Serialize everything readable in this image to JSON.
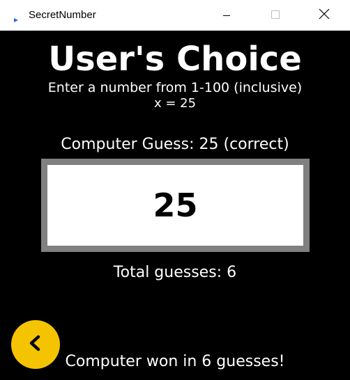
{
  "window": {
    "title": "SecretNumber",
    "icons": {
      "app": "app-icon",
      "minimize": "minimize-icon",
      "maximize": "maximize-icon",
      "close": "close-icon"
    }
  },
  "main": {
    "heading": "User's Choice",
    "instructions": "Enter a number from 1-100 (inclusive)",
    "x_value": "x = 25",
    "guess_label": "Computer Guess: 25 (correct)",
    "guess_number": "25",
    "total_guesses": "Total guesses: 6",
    "result": "Computer won in 6 guesses!"
  },
  "back_button": {
    "icon": "chevron-left-icon"
  },
  "colors": {
    "background": "#000000",
    "text": "#ffffff",
    "box_border": "#808080",
    "box_fill": "#ffffff",
    "back_button": "#f5c400",
    "app_icon": "#1e6fd9"
  }
}
